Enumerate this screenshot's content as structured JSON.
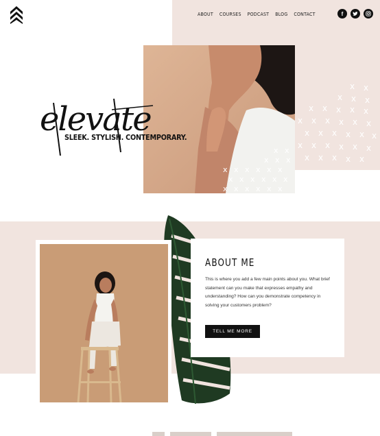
{
  "nav": {
    "items": [
      "ABOUT",
      "COURSES",
      "PODCAST",
      "BLOG",
      "CONTACT"
    ]
  },
  "social": [
    {
      "name": "facebook-icon",
      "glyph": "f"
    },
    {
      "name": "twitter-icon",
      "glyph": "t"
    },
    {
      "name": "instagram-icon",
      "glyph": "◎"
    }
  ],
  "hero": {
    "script_word": "elevate",
    "tagline": "SLEEK. STYLISH. CONTEMPORARY."
  },
  "about": {
    "title": "ABOUT ME",
    "body": "This is where you add a few main points about you. What brief statement can you make that expresses empathy and understanding?  How can you demonstrate competency in solving your customers problem?",
    "button_label": "TELL ME MORE"
  },
  "colors": {
    "blush": "#f1e4df",
    "photo_tan": "#d7ab8a",
    "ink": "#111111"
  }
}
